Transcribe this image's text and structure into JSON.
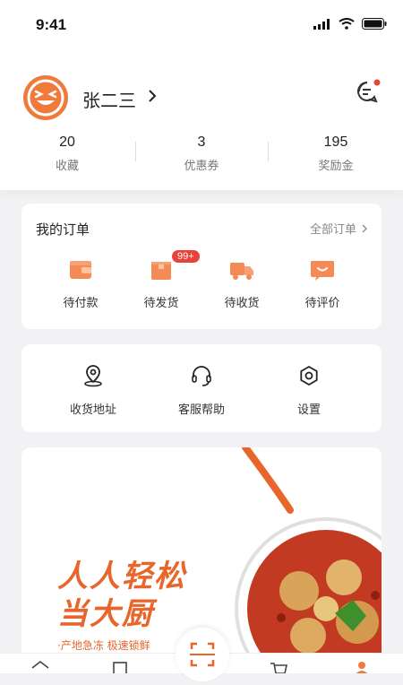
{
  "status_bar": {
    "time": "9:41"
  },
  "profile": {
    "name": "张二三"
  },
  "stats": [
    {
      "value": "20",
      "label": "收藏"
    },
    {
      "value": "3",
      "label": "优惠券"
    },
    {
      "value": "195",
      "label": "奖励金"
    }
  ],
  "orders": {
    "title": "我的订单",
    "view_all": "全部订单",
    "items": [
      {
        "label": "待付款",
        "icon": "wallet-icon"
      },
      {
        "label": "待发货",
        "icon": "box-icon",
        "badge": "99+"
      },
      {
        "label": "待收货",
        "icon": "truck-icon"
      },
      {
        "label": "待评价",
        "icon": "review-icon"
      }
    ]
  },
  "services": [
    {
      "label": "收货地址",
      "icon": "location-icon"
    },
    {
      "label": "客服帮助",
      "icon": "headset-icon"
    },
    {
      "label": "设置",
      "icon": "gear-icon"
    }
  ],
  "banner": {
    "line1": "人人轻松",
    "line2": "当大厨",
    "caption": "·产地急冻 极速锁鲜"
  },
  "colors": {
    "accent": "#f07a3c",
    "badge": "#e94238"
  }
}
